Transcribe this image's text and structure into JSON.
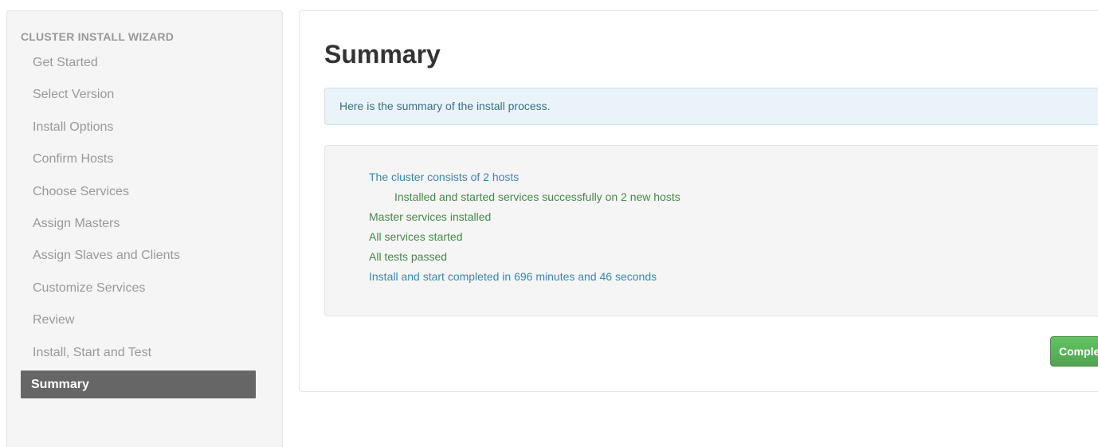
{
  "sidebar": {
    "header": "CLUSTER INSTALL WIZARD",
    "items": [
      {
        "label": "Get Started"
      },
      {
        "label": "Select Version"
      },
      {
        "label": "Install Options"
      },
      {
        "label": "Confirm Hosts"
      },
      {
        "label": "Choose Services"
      },
      {
        "label": "Assign Masters"
      },
      {
        "label": "Assign Slaves and Clients"
      },
      {
        "label": "Customize Services"
      },
      {
        "label": "Review"
      },
      {
        "label": "Install, Start and Test"
      },
      {
        "label": "Summary"
      }
    ],
    "active_index": 10
  },
  "main": {
    "title": "Summary",
    "alert_text": "Here is the summary of the install process.",
    "summary_lines": [
      {
        "text": "The cluster consists of 2 hosts",
        "status": "info"
      },
      {
        "text": "Installed and started services successfully on 2 new hosts",
        "status": "success"
      },
      {
        "text": "Master services installed",
        "status": "success"
      },
      {
        "text": "All services started",
        "status": "success"
      },
      {
        "text": "All tests passed",
        "status": "success"
      },
      {
        "text": "Install and start completed in 696 minutes and 46 seconds",
        "status": "info"
      }
    ],
    "complete_button_label": "Complete"
  },
  "colors": {
    "active_nav_bg": "#666666",
    "info_text": "#3a87ad",
    "success_text": "#468847",
    "alert_bg": "#eaf3f7",
    "button_green": "#51a351"
  }
}
